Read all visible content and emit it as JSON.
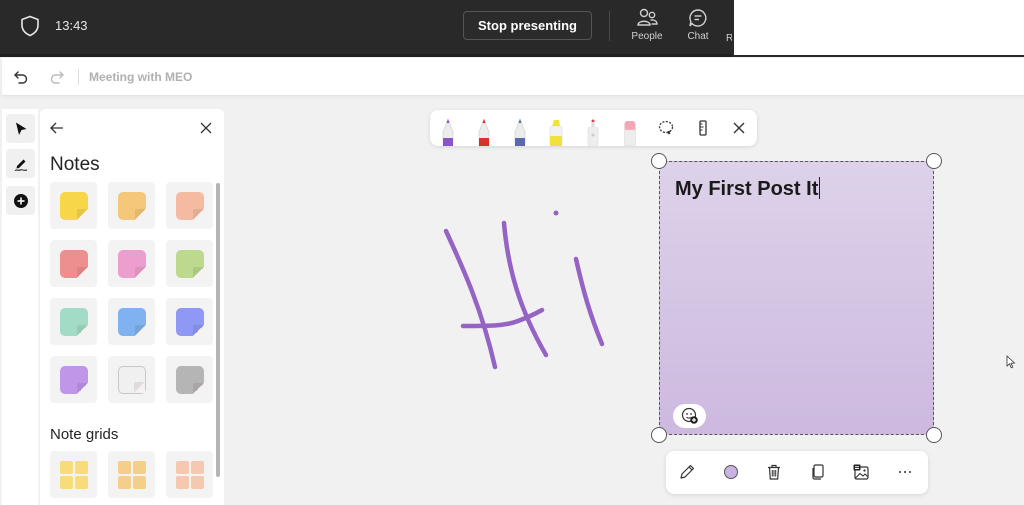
{
  "teams_bar": {
    "time": "13:43",
    "stop_presenting_label": "Stop presenting",
    "people_label": "People",
    "chat_label": "Chat",
    "cut_label": "R",
    "icons": [
      "shield-icon",
      "people-icon",
      "chat-icon"
    ]
  },
  "whiteboard": {
    "title": "Meeting with MEO",
    "undo_icon": "undo-icon",
    "redo_icon": "redo-icon"
  },
  "rail": {
    "tools": [
      {
        "name": "select",
        "icon": "pointer-icon"
      },
      {
        "name": "inking",
        "icon": "pen-signature-icon"
      },
      {
        "name": "create",
        "icon": "add-circle-icon"
      }
    ]
  },
  "notes_panel": {
    "title": "Notes",
    "grids_title": "Note grids",
    "notes": [
      {
        "color": "#f7d64a"
      },
      {
        "color": "#f5c77a"
      },
      {
        "color": "#f4bba0"
      },
      {
        "color": "#ee8f8f"
      },
      {
        "color": "#ec9fcf"
      },
      {
        "color": "#bcd98e"
      },
      {
        "color": "#a3dcc6"
      },
      {
        "color": "#7fb2ee"
      },
      {
        "color": "#8f98f5"
      },
      {
        "color": "#bf96e8"
      },
      {
        "color": "#f0f0f0"
      },
      {
        "color": "#b5b5b5"
      }
    ],
    "grids": [
      {
        "color": "#f8dc7a"
      },
      {
        "color": "#f5cf8a"
      },
      {
        "color": "#f6c8b0"
      }
    ]
  },
  "pen_toolbar": {
    "pens": [
      {
        "name": "pen-purple",
        "color": "#8a55c8"
      },
      {
        "name": "pen-red",
        "color": "#d9302c"
      },
      {
        "name": "pen-rainbow",
        "color": "#5a6ab0"
      },
      {
        "name": "highlighter-yellow",
        "color": "#f1e23a"
      },
      {
        "name": "laser-pointer",
        "color": "#e04050"
      },
      {
        "name": "eraser",
        "color": "#f2a8b8"
      }
    ],
    "tools": [
      "lasso-icon",
      "ruler-icon",
      "close-icon"
    ]
  },
  "ink": {
    "color": "#9563c4",
    "text": "Hi"
  },
  "sticky_note": {
    "text": "My First Post It",
    "color": "#d5c5e6"
  },
  "context_toolbar": {
    "buttons": [
      "edit-icon",
      "color-icon",
      "delete-icon",
      "copy-icon",
      "image-icon",
      "more-icon"
    ],
    "current_color": "#c9b3e3"
  }
}
